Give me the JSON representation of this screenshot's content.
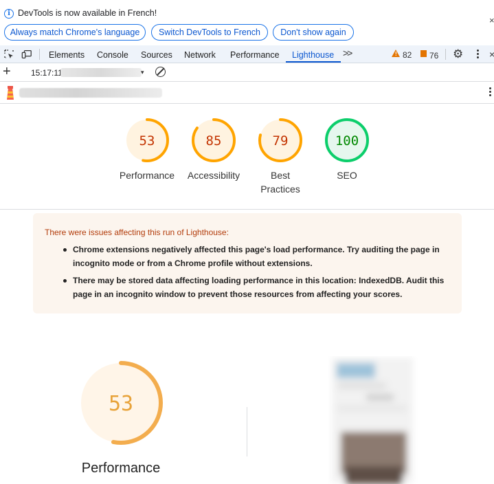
{
  "infobar": {
    "message": "DevTools is now available in French!",
    "buttons": [
      "Always match Chrome's language",
      "Switch DevTools to French",
      "Don't show again"
    ],
    "close": "×"
  },
  "tabs": {
    "items": [
      "Elements",
      "Console",
      "Sources",
      "Network",
      "Performance",
      "Lighthouse"
    ],
    "active": "Lighthouse",
    "more": ">>",
    "warnings_count": "82",
    "issues_count": "76"
  },
  "toolbar": {
    "report_time": "15:17:11"
  },
  "scores": [
    {
      "label": "Performance",
      "value": "53",
      "score": 0.53,
      "color": "#c33300",
      "ring": "#ffa400",
      "bg": "#fff3e0"
    },
    {
      "label": "Accessibility",
      "value": "85",
      "score": 0.85,
      "color": "#c33300",
      "ring": "#ffa400",
      "bg": "#fff3e0"
    },
    {
      "label": "Best Practices",
      "value": "79",
      "score": 0.79,
      "color": "#c33300",
      "ring": "#ffa400",
      "bg": "#fff3e0"
    },
    {
      "label": "SEO",
      "value": "100",
      "score": 1.0,
      "color": "#008800",
      "ring": "#0cce6b",
      "bg": "#e6f7ee"
    }
  ],
  "warnings": {
    "title": "There were issues affecting this run of Lighthouse:",
    "items": [
      "Chrome extensions negatively affected this page's load performance. Try auditing the page in incognito mode or from a Chrome profile without extensions.",
      "There may be stored data affecting loading performance in this location: IndexedDB. Audit this page in an incognito window to prevent those resources from affecting your scores."
    ]
  },
  "main_gauge": {
    "value": "53",
    "score": 0.53,
    "label": "Performance",
    "color": "#e8a33a",
    "ring": "#f3ad4e",
    "bg": "#fff5e8"
  }
}
